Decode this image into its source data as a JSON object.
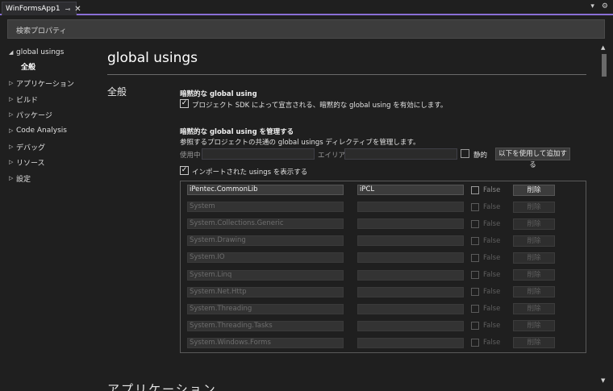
{
  "tab": {
    "title": "WinFormsApp1",
    "pin_icon": "pin-icon",
    "close_icon": "close-icon"
  },
  "window_icons": {
    "dropdown": "▾",
    "settings": "⚙"
  },
  "search": {
    "placeholder": "検索プロパティ"
  },
  "sidebar": {
    "items": [
      {
        "label": "global usings",
        "expanded": true,
        "children": [
          "全般"
        ]
      },
      {
        "label": "アプリケーション",
        "expanded": false
      },
      {
        "label": "ビルド",
        "expanded": false
      },
      {
        "label": "パッケージ",
        "expanded": false
      },
      {
        "label": "Code Analysis",
        "expanded": false
      },
      {
        "label": "デバッグ",
        "expanded": false
      },
      {
        "label": "リソース",
        "expanded": false
      },
      {
        "label": "設定",
        "expanded": false
      }
    ]
  },
  "main": {
    "title": "global usings",
    "section": "全般",
    "next_section": "アプリケーション",
    "implicit": {
      "heading": "暗黙的な global using",
      "checkbox_label": "プロジェクト SDK によって宣言される、暗黙的な global using を有効にします。",
      "checked": true
    },
    "manage": {
      "heading": "暗黙的な global using を管理する",
      "description": "参照するプロジェクトの共通の global usings ディレクティブを管理します。",
      "using_label": "使用中",
      "alias_label": "エイリアス",
      "static_label": "静的",
      "add_button": "以下を使用して追加する",
      "show_imported_label": "インポートされた usings を表示する",
      "show_imported_checked": true
    },
    "usings": {
      "delete_label": "削除",
      "rows": [
        {
          "using": "iPentec.CommonLib",
          "alias": "iPCL",
          "static": "False",
          "active": true
        },
        {
          "using": "System",
          "alias": "",
          "static": "False",
          "active": false
        },
        {
          "using": "System.Collections.Generic",
          "alias": "",
          "static": "False",
          "active": false
        },
        {
          "using": "System.Drawing",
          "alias": "",
          "static": "False",
          "active": false
        },
        {
          "using": "System.IO",
          "alias": "",
          "static": "False",
          "active": false
        },
        {
          "using": "System.Linq",
          "alias": "",
          "static": "False",
          "active": false
        },
        {
          "using": "System.Net.Http",
          "alias": "",
          "static": "False",
          "active": false
        },
        {
          "using": "System.Threading",
          "alias": "",
          "static": "False",
          "active": false
        },
        {
          "using": "System.Threading.Tasks",
          "alias": "",
          "static": "False",
          "active": false
        },
        {
          "using": "System.Windows.Forms",
          "alias": "",
          "static": "False",
          "active": false
        }
      ]
    }
  },
  "colors": {
    "accent": "#8a6fd6",
    "background": "#1f1f1f"
  }
}
